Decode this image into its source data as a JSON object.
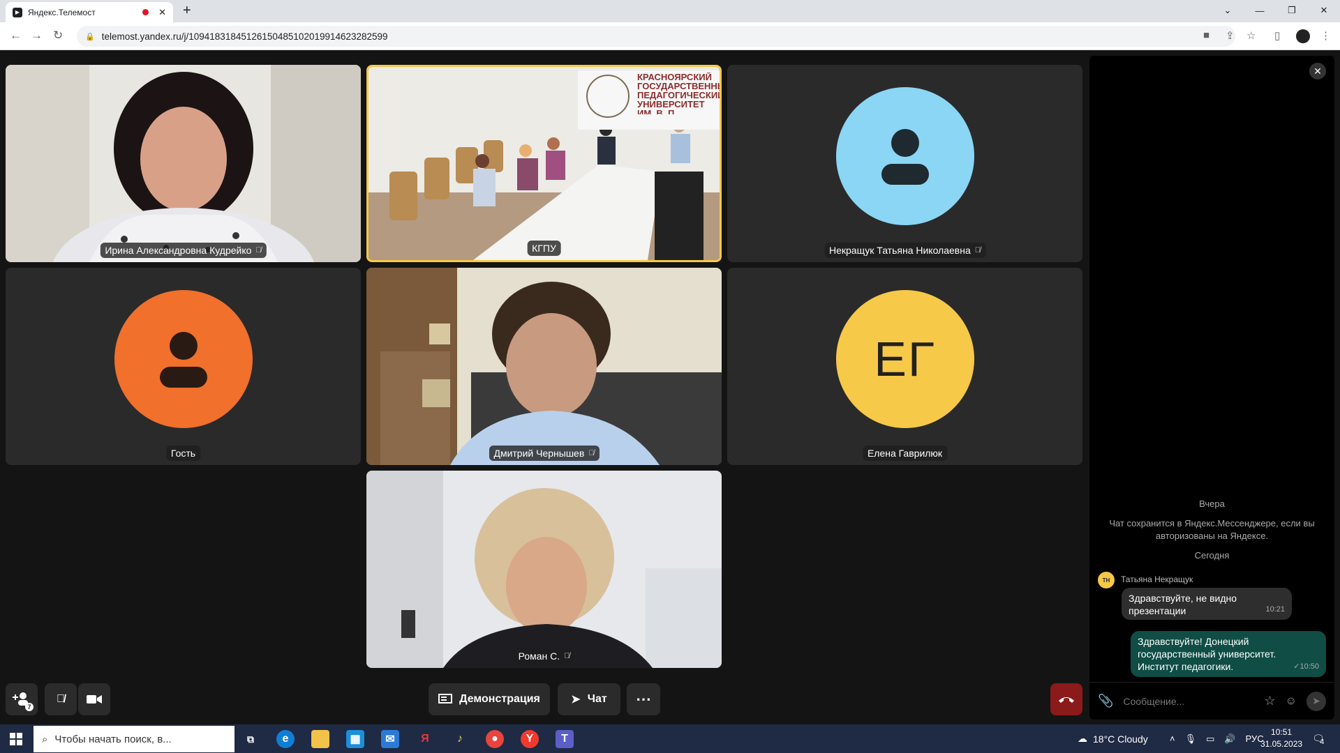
{
  "browser": {
    "tab_title": "Яндекс.Телемост",
    "url": "telemost.yandex.ru/j/10941831845126150485102019914623282599"
  },
  "tiles": [
    {
      "name": "Ирина Александровна Кудрейко",
      "muted": true,
      "type": "video"
    },
    {
      "name": "КГПУ",
      "muted": false,
      "type": "video",
      "active": true,
      "sign_text": "КРАСНОЯРСКИЙ ГОСУДАРСТВЕННЫЙ ПЕДАГОГИЧЕСКИЙ УНИВЕРСИТЕТ ИМ. В. П. АСТАФЬЕВА"
    },
    {
      "name": "Некращук Татьяна Николаевна",
      "muted": true,
      "type": "avatar",
      "color": "#8ad6f4"
    },
    {
      "name": "Гость",
      "muted": false,
      "type": "avatar",
      "color": "#f0702c"
    },
    {
      "name": "Дмитрий Чернышев",
      "muted": true,
      "type": "video"
    },
    {
      "name": "Елена Гаврилюк",
      "muted": false,
      "type": "initials",
      "initials": "ЕГ",
      "color": "#f7c948"
    },
    {
      "name": "Роман С.",
      "muted": true,
      "type": "video"
    }
  ],
  "controls": {
    "participants_count": "7",
    "demo_label": "Демонстрация",
    "chat_label": "Чат",
    "more_label": "⋯"
  },
  "chat": {
    "day1": "Вчера",
    "notice": "Чат сохранится в Яндекс.Мессенджере, если вы авторизованы на Яндексе.",
    "day2": "Сегодня",
    "sender_initials": "ТН",
    "sender_name": "Татьяна Некращук",
    "msg1": "Здравствуйте, не видно презентации",
    "msg1_time": "10:21",
    "msg2": "Здравствуйте! Донецкий государственный университет. Институт педагогики.",
    "msg2_time": "✓10:50",
    "input_placeholder": "Сообщение..."
  },
  "taskbar": {
    "search_placeholder": "Чтобы начать поиск, в...",
    "weather": "18°C  Cloudy",
    "lang": "РУС",
    "time": "10:51",
    "date": "31.05.2023",
    "notif_count": "4"
  }
}
